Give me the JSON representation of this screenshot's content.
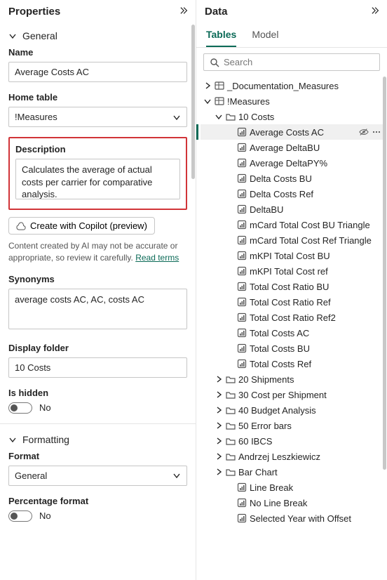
{
  "properties": {
    "title": "Properties",
    "general": {
      "header": "General",
      "name_label": "Name",
      "name_value": "Average Costs AC",
      "home_table_label": "Home table",
      "home_table_value": "!Measures",
      "description_label": "Description",
      "description_value": "Calculates the average of actual costs per carrier for comparative analysis.",
      "copilot_label": "Create with Copilot (preview)",
      "ai_hint": "Content created by AI may not be accurate or appropriate, so review it carefully. ",
      "ai_link": "Read terms",
      "synonyms_label": "Synonyms",
      "synonyms_value": "average costs AC, AC, costs AC",
      "display_folder_label": "Display folder",
      "display_folder_value": "10 Costs",
      "is_hidden_label": "Is hidden",
      "is_hidden_value": "No"
    },
    "formatting": {
      "header": "Formatting",
      "format_label": "Format",
      "format_value": "General",
      "pct_label": "Percentage format",
      "pct_value": "No"
    }
  },
  "data": {
    "title": "Data",
    "tabs": {
      "tables": "Tables",
      "model": "Model"
    },
    "search_placeholder": "Search",
    "nodes": {
      "doc_measures": "_Documentation_Measures",
      "measures": "!Measures",
      "folder_10costs": "10 Costs",
      "m": [
        "Average Costs AC",
        "Average DeltaBU",
        "Average DeltaPY%",
        "Delta Costs BU",
        "Delta Costs Ref",
        "DeltaBU",
        "mCard Total Cost BU Triangle",
        "mCard Total Cost Ref Triangle",
        "mKPI Total Cost BU",
        "mKPI Total Cost ref",
        "Total Cost Ratio BU",
        "Total Cost Ratio Ref",
        "Total Cost Ratio Ref2",
        "Total Costs AC",
        "Total Costs BU",
        "Total Costs Ref"
      ],
      "folders": [
        "20 Shipments",
        "30 Cost per Shipment",
        "40 Budget Analysis",
        "50 Error bars",
        "60 IBCS",
        "Andrzej Leszkiewicz",
        "Bar Chart"
      ],
      "bar_chart_m": [
        "Line Break",
        "No Line Break",
        "Selected Year with Offset"
      ]
    }
  }
}
